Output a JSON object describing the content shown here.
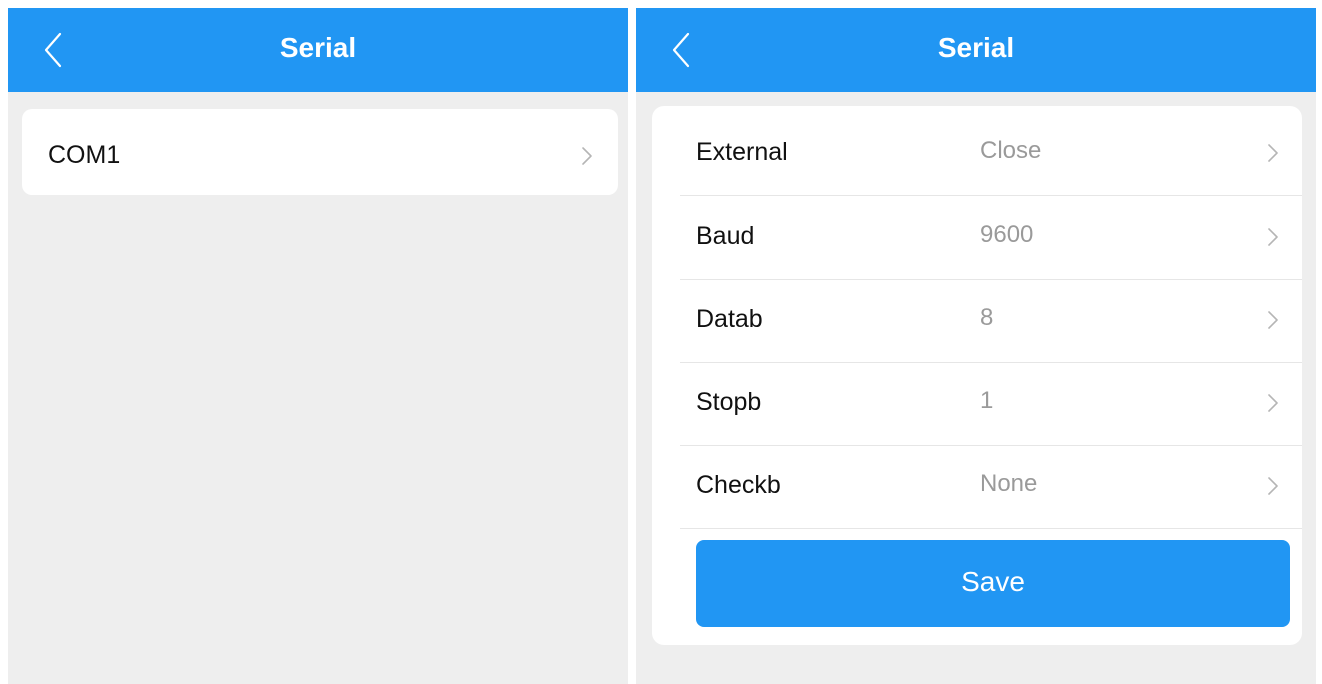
{
  "theme": {
    "header_color": "#2196f3",
    "background_color": "#eeeeee",
    "value_color": "#9a9a9a"
  },
  "left_screen": {
    "header": {
      "title": "Serial",
      "back_icon": "chevron-left-icon"
    },
    "ports": [
      {
        "label": "COM1",
        "icon": "chevron-right-icon"
      }
    ]
  },
  "right_screen": {
    "header": {
      "title": "Serial",
      "back_icon": "chevron-left-icon"
    },
    "settings": [
      {
        "label": "External",
        "value": "Close"
      },
      {
        "label": "Baud",
        "value": "9600"
      },
      {
        "label": "Datab",
        "value": "8"
      },
      {
        "label": "Stopb",
        "value": "1"
      },
      {
        "label": "Checkb",
        "value": "None"
      }
    ],
    "save_label": "Save"
  }
}
